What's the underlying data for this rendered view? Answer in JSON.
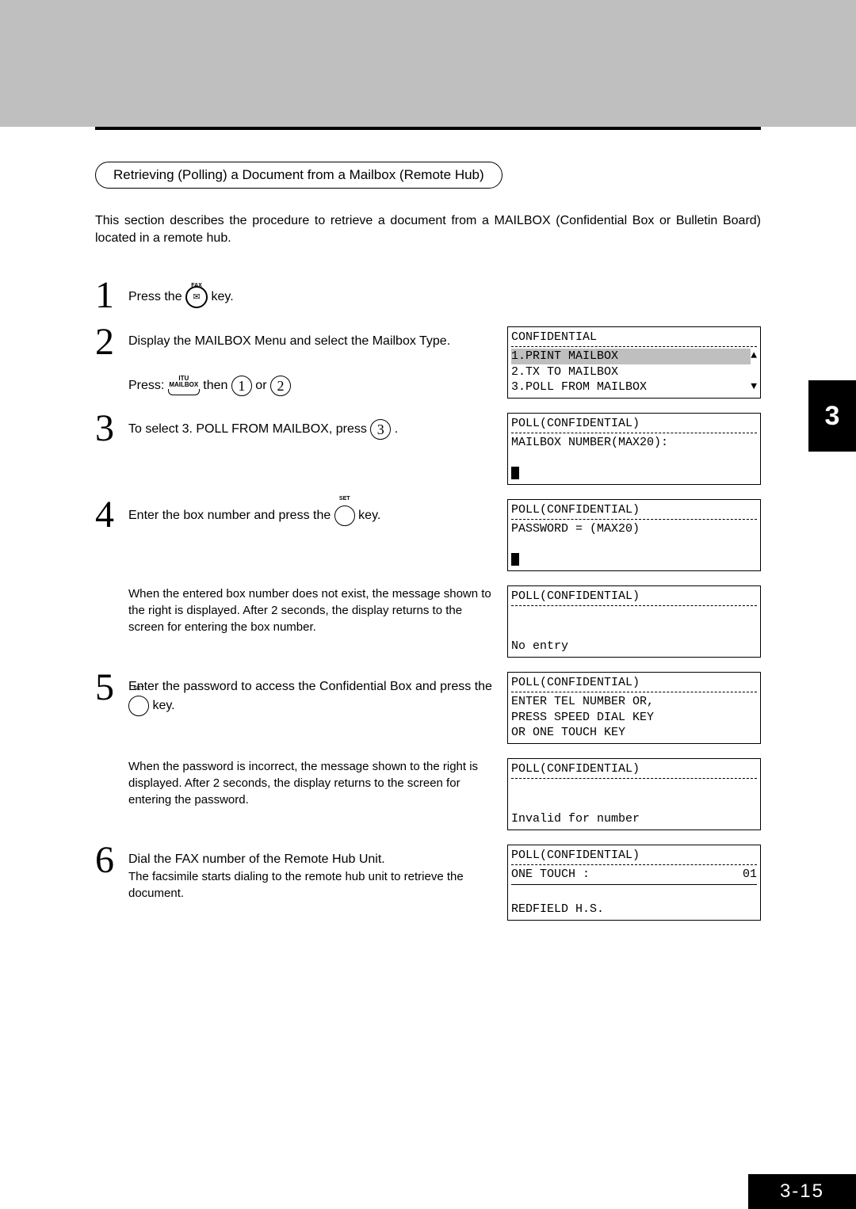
{
  "chapter_tab": "3",
  "page_number": "3-15",
  "header": {
    "title": "Retrieving (Polling) a Document from a Mailbox (Remote Hub)"
  },
  "intro": "This section describes the procedure to retrieve a document from a MAILBOX (Confidential Box or Bulletin Board) located in a remote hub.",
  "keys": {
    "fax_label": "FAX",
    "itu": "ITU",
    "mailbox": "MAILBOX",
    "set": "SET",
    "one": "1",
    "two": "2",
    "three": "3"
  },
  "steps": {
    "s1": {
      "num": "1",
      "t1": "Press the ",
      "t2": " key."
    },
    "s2": {
      "num": "2",
      "text": "Display the MAILBOX Menu and select the Mailbox Type.",
      "p1": "Press: ",
      "p2": " then ",
      "p3": " or "
    },
    "s3": {
      "num": "3",
      "t1": "To select   3. POLL FROM MAILBOX,   press ",
      "t2": " ."
    },
    "s4": {
      "num": "4",
      "t1": "Enter the box number and press the ",
      "t2": " key."
    },
    "s4note": "When the entered box number does not exist, the message shown to the right is displayed.  After 2 seconds, the display returns to the screen for entering the box number.",
    "s5": {
      "num": "5",
      "t1": "Enter the password to access the Confidential Box and press the ",
      "t2": " key."
    },
    "s5note": "When the password is incorrect, the message shown to the right is displayed. After 2 seconds, the display returns to the screen for entering the password.",
    "s6": {
      "num": "6",
      "text": "Dial the FAX number of the Remote Hub Unit.",
      "sub": "The facsimile starts dialing to the remote hub unit to retrieve the document."
    }
  },
  "screens": {
    "menu": {
      "hdr": "CONFIDENTIAL",
      "o1": "1.PRINT MAILBOX",
      "o2": "2.TX TO MAILBOX",
      "o3": "3.POLL FROM MAILBOX"
    },
    "boxnum": {
      "hdr": "POLL(CONFIDENTIAL)",
      "l1": "MAILBOX NUMBER(MAX20):"
    },
    "pass": {
      "hdr": "POLL(CONFIDENTIAL)",
      "l1": "PASSWORD = (MAX20)"
    },
    "noentry": {
      "hdr": "POLL(CONFIDENTIAL)",
      "l1": "No entry"
    },
    "entertel": {
      "hdr": "POLL(CONFIDENTIAL)",
      "l1": "ENTER TEL NUMBER OR,",
      "l2": "PRESS SPEED DIAL KEY",
      "l3": "OR ONE TOUCH KEY"
    },
    "invalid": {
      "hdr": "POLL(CONFIDENTIAL)",
      "l1": "Invalid for number"
    },
    "dial": {
      "hdr": "POLL(CONFIDENTIAL)",
      "l1": "ONE TOUCH :",
      "l1r": "01",
      "l2": "REDFIELD H.S."
    }
  }
}
